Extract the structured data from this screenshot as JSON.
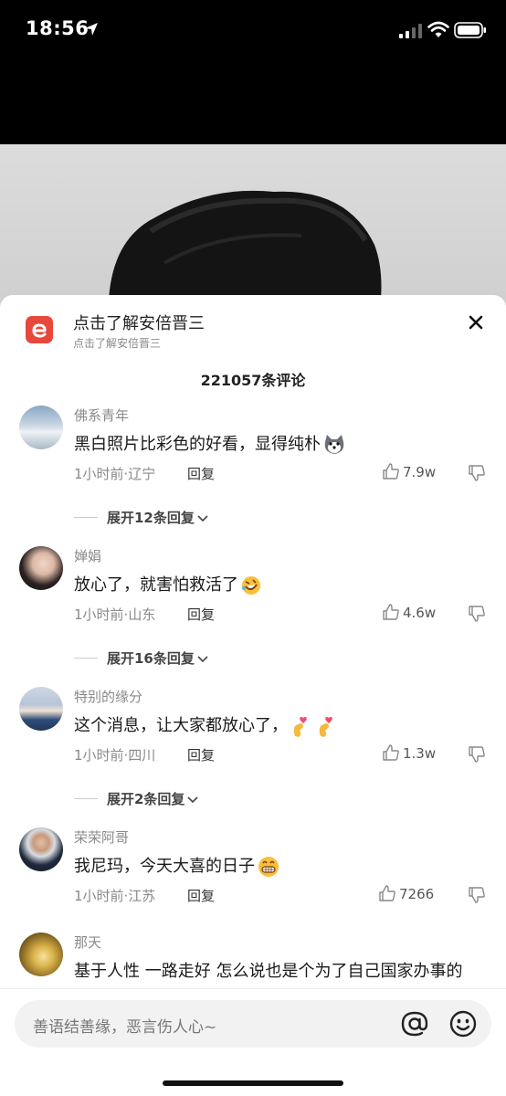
{
  "status": {
    "time": "18:56"
  },
  "header": {
    "title": "点击了解安倍晋三",
    "subtitle": "点击了解安倍晋三"
  },
  "comments_count": "221057条评论",
  "comments": [
    {
      "user": "佛系青年",
      "text": "黑白照片比彩色的好看，显得纯朴",
      "meta": "1小时前·辽宁",
      "reply": "回复",
      "likes": "7.9w",
      "expand": "展开12条回复"
    },
    {
      "user": "婵娟",
      "text": "放心了，就害怕救活了",
      "meta": "1小时前·山东",
      "reply": "回复",
      "likes": "4.6w",
      "expand": "展开16条回复"
    },
    {
      "user": "特别的缘分",
      "text": "这个消息，让大家都放心了，",
      "meta": "1小时前·四川",
      "reply": "回复",
      "likes": "1.3w",
      "expand": "展开2条回复"
    },
    {
      "user": "荣荣阿哥",
      "text": "我尼玛，今天大喜的日子",
      "meta": "1小时前·江苏",
      "reply": "回复",
      "likes": "7266",
      "expand": ""
    },
    {
      "user": "那天",
      "text": "基于人性 一路走好 怎么说也是个为了自己国家办事的",
      "meta": "",
      "reply": "",
      "likes": "",
      "expand": ""
    }
  ],
  "input": {
    "placeholder": "善语结善缘，恶言伤人心~"
  },
  "colors": {
    "accent": "#e8483c",
    "text": "#1a1a1a",
    "muted": "#8a8a8a"
  }
}
